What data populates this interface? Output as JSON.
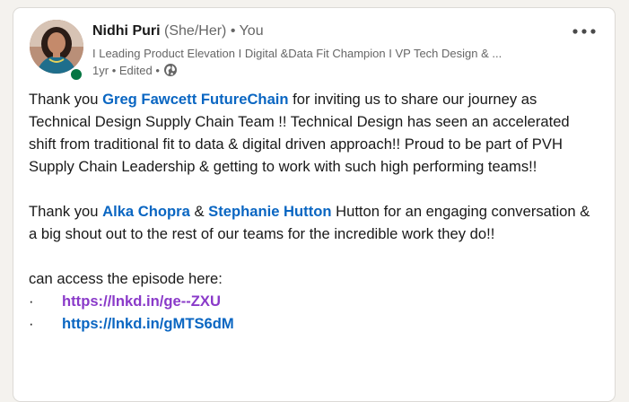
{
  "post": {
    "author": {
      "name": "Nidhi Puri",
      "pronouns": "(She/Her)",
      "connection": "• You",
      "headline": "I Leading Product Elevation I Digital &Data Fit Champion I VP Tech Design & ...",
      "time": "1yr",
      "edited": "• Edited •",
      "visibility_icon": "globe-icon",
      "presence_color": "#057642"
    },
    "more_icon": "ellipsis-icon",
    "paragraph1": {
      "text_before": "Thank you ",
      "mention": "Greg Fawcett FutureChain",
      "text_after": " for inviting us to share our journey as Technical Design Supply Chain Team !! Technical Design has seen an accelerated shift from traditional fit to data & digital driven approach!! Proud to be part of PVH Supply Chain Leadership & getting to work with such high performing teams!!"
    },
    "paragraph2": {
      "text_before": "Thank you ",
      "mention1": "Alka Chopra",
      "separator": " & ",
      "mention2": "Stephanie Hutton",
      "text_after": " Hutton for an engaging conversation & a big shout out to the rest of our teams for the incredible work they do!!"
    },
    "paragraph3": {
      "text": "can access the episode here:"
    },
    "links": [
      {
        "bullet": "·",
        "url": "https://lnkd.in/ge--ZXU"
      },
      {
        "bullet": "·",
        "url": "https://lnkd.in/gMTS6dM"
      }
    ],
    "colors": {
      "mention": "#0a66c2",
      "visited_link": "#8a3ac9"
    }
  }
}
